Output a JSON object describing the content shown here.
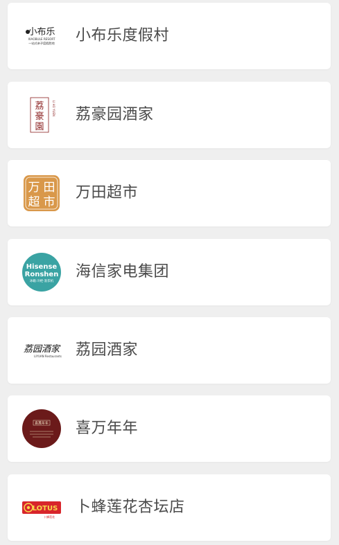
{
  "merchants": [
    {
      "name": "小布乐度假村",
      "logo": {
        "type": "wordmark",
        "title": "小布乐",
        "sub1": "XIAOBULE RESORT",
        "sub2": "一站式亲子度假胜地",
        "color": "#222222"
      }
    },
    {
      "name": "荔豪园酒家",
      "logo": {
        "type": "seal",
        "chars": "荔豪園",
        "side": "LI HO YUEN",
        "color": "#8a1f1f"
      }
    },
    {
      "name": "万田超市",
      "logo": {
        "type": "square",
        "chars": [
          "万",
          "田",
          "超",
          "市"
        ],
        "bg": "#d9984a",
        "fg": "#ffffff"
      }
    },
    {
      "name": "海信家电集团",
      "logo": {
        "type": "circle",
        "line1": "Hisense",
        "line2": "Ronshen",
        "line3": "冰箱·冷柜·洗衣机",
        "bg": "#3aa3a3",
        "fg": "#ffffff"
      }
    },
    {
      "name": "荔园酒家",
      "logo": {
        "type": "script",
        "chars": "荔园酒家",
        "sub": "LIYUAN Restaurants",
        "color": "#111111"
      }
    },
    {
      "name": "喜万年年",
      "logo": {
        "type": "dark-circle",
        "chars": "喜萬年年",
        "bg": "#6b1a1a",
        "fg": "#f3e7c9"
      }
    },
    {
      "name": "卜蜂莲花杏坛店",
      "logo": {
        "type": "badge",
        "text": "LOTUS",
        "sub": "卜蜂莲花",
        "bg": "#d8252b",
        "fg": "#f7d94a"
      }
    }
  ]
}
